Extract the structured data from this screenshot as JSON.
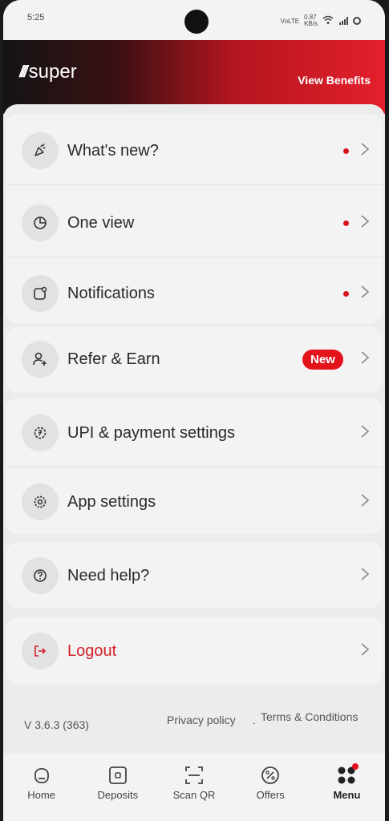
{
  "status_bar": {
    "time": "5:25",
    "network": "VoLTE",
    "speed": "0.87",
    "speed_unit": "KB/s"
  },
  "header": {
    "logo_mark": "///",
    "logo_text": "super",
    "benefits_label": "View Benefits",
    "gradient_colors": [
      "#141414",
      "#e4202c"
    ]
  },
  "menu": {
    "items": [
      {
        "label": "What's new?",
        "icon": "party-popper-icon",
        "has_dot": true
      },
      {
        "label": "One view",
        "icon": "pie-chart-icon",
        "has_dot": true
      },
      {
        "label": "Notifications",
        "icon": "notification-icon",
        "has_dot": true
      },
      {
        "label": "Refer & Earn",
        "icon": "add-user-icon",
        "badge": "New"
      },
      {
        "label": "UPI & payment settings",
        "icon": "payment-settings-icon"
      },
      {
        "label": "App settings",
        "icon": "gear-icon"
      },
      {
        "label": "Need help?",
        "icon": "help-icon"
      },
      {
        "label": "Logout",
        "icon": "logout-icon",
        "color": "#d42029"
      }
    ]
  },
  "footer": {
    "version": "V 3.6.3 (363)",
    "privacy_label": "Privacy policy",
    "separator": ".",
    "terms_label": "Terms & Conditions"
  },
  "bottom_nav": {
    "items": [
      {
        "label": "Home",
        "icon": "home-icon"
      },
      {
        "label": "Deposits",
        "icon": "deposits-icon"
      },
      {
        "label": "Scan QR",
        "icon": "scan-qr-icon"
      },
      {
        "label": "Offers",
        "icon": "offers-icon"
      },
      {
        "label": "Menu",
        "icon": "menu-grid-icon",
        "active": true
      }
    ]
  },
  "colors": {
    "accent": "#e3131c",
    "background": "#ececec",
    "card": "#f3f3f3"
  }
}
